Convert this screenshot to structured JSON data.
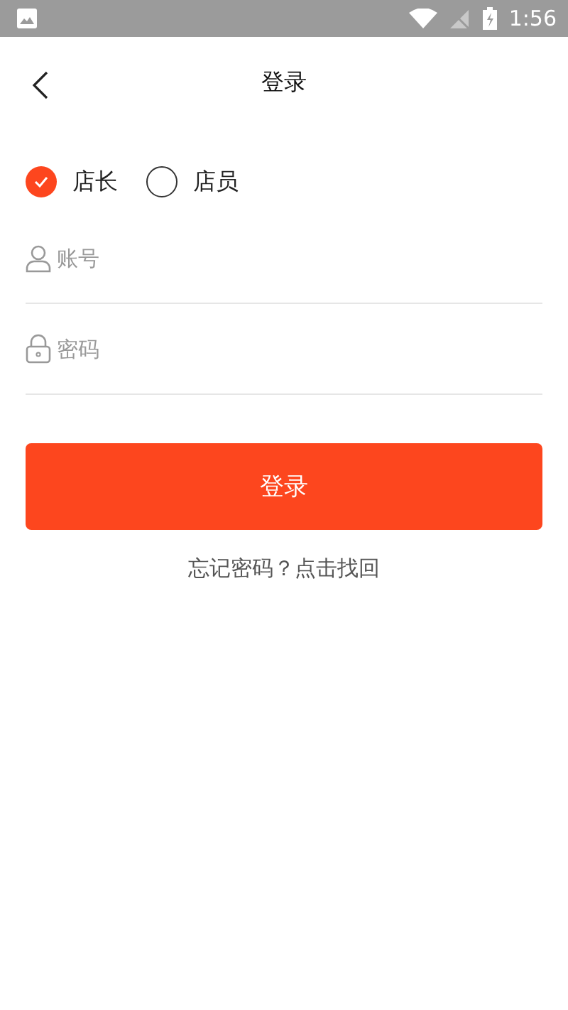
{
  "status_bar": {
    "time": "1:56"
  },
  "header": {
    "title": "登录"
  },
  "roles": [
    {
      "label": "店长",
      "selected": true
    },
    {
      "label": "店员",
      "selected": false
    }
  ],
  "fields": [
    {
      "kind": "user",
      "placeholder": "账号"
    },
    {
      "kind": "lock",
      "placeholder": "密码"
    }
  ],
  "login_button": "登录",
  "forgot_link": "忘记密码？点击找回"
}
